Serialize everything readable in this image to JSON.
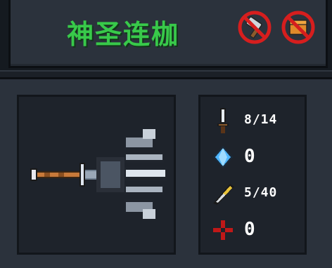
{
  "weapon": {
    "name": "神圣连枷",
    "restrictions": [
      {
        "icon": "no-hammer-icon"
      },
      {
        "icon": "no-chest-icon"
      }
    ]
  },
  "stats": [
    {
      "icon": "sword-damage-icon",
      "value": "8/14"
    },
    {
      "icon": "crystal-energy-icon",
      "value": "0"
    },
    {
      "icon": "feather-attack-speed-icon",
      "value": "5/40"
    },
    {
      "icon": "crosshair-accuracy-icon",
      "value": "0"
    }
  ],
  "colors": {
    "title": "#38c94a",
    "panel": "#2b323c",
    "inner": "#1e232b",
    "ban_red": "#d61e1e"
  }
}
